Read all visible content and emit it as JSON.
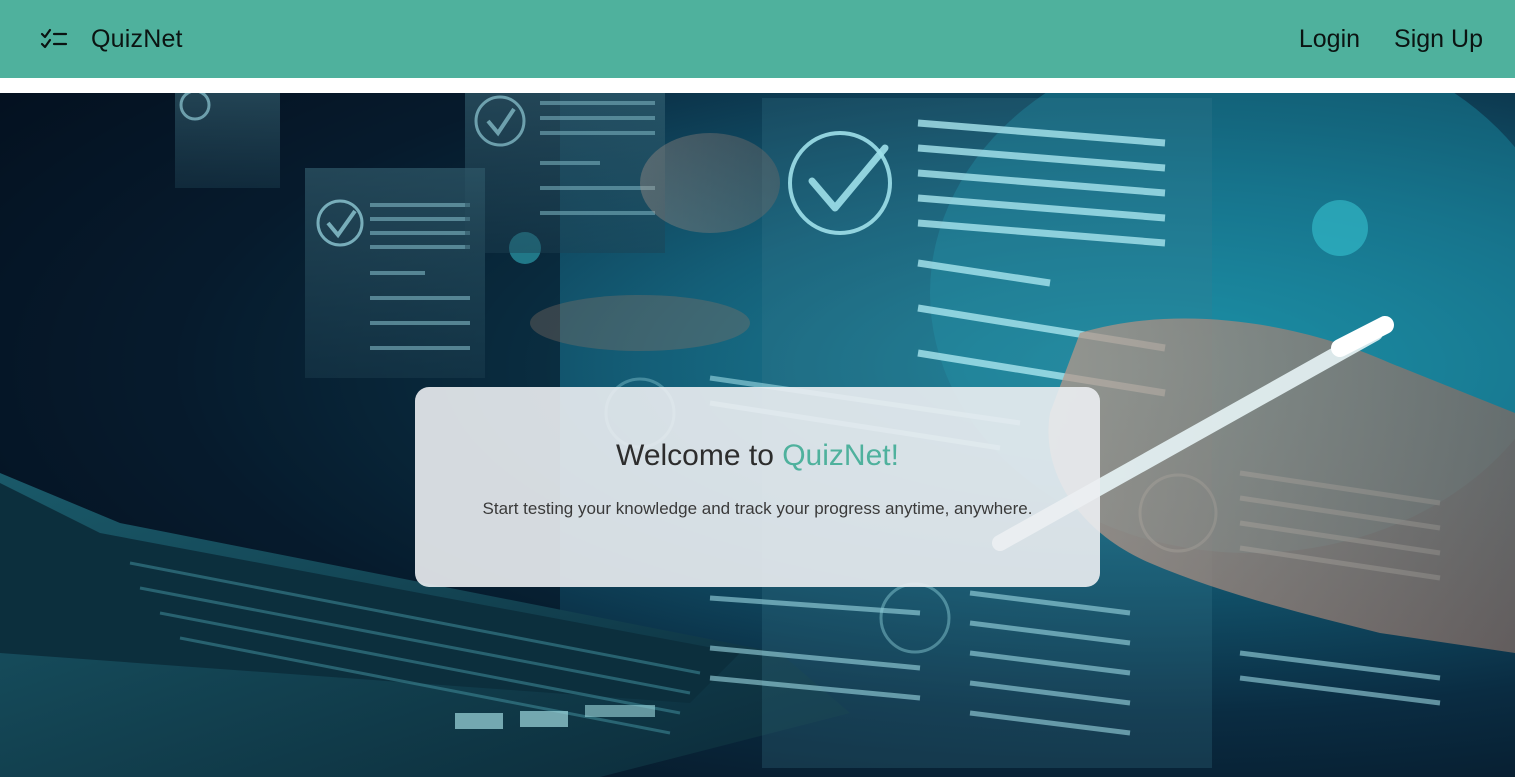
{
  "navbar": {
    "brand_name": "QuizNet",
    "brand_icon": "checklist-icon",
    "links": {
      "login": "Login",
      "signup": "Sign Up"
    },
    "background_color": "#4fb19d"
  },
  "hero": {
    "background_description_icon": "checkmark-document-icon",
    "welcome": {
      "title_prefix": "Welcome to ",
      "title_accent": "QuizNet!",
      "subtitle": "Start testing your knowledge and track your progress anytime, anywhere."
    },
    "accent_color": "#4fb19d"
  }
}
